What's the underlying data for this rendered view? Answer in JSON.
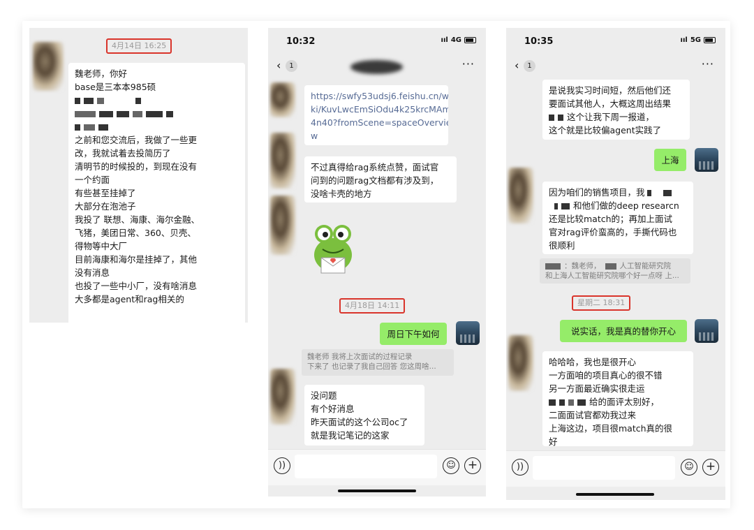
{
  "panel1": {
    "timestamp": "4月14日 16:25",
    "message_lines": [
      "魏老师，你好",
      "base是三本本985硕",
      "之前和您交流后，我做了一些更",
      "改，我就试着去投简历了",
      "清明节的时候投的，到现在没有",
      "一个约面",
      "有些甚至挂掉了",
      "大部分在泡池子",
      "我投了 联想、海康、海尔金融、",
      "飞猪，美团日常、360、贝壳、",
      "得物等中大厂",
      "目前海康和海尔是挂掉了，其他",
      "没有消息",
      "也投了一些中小厂，没有啥消息",
      "大多都是agent和rag相关的"
    ]
  },
  "panel2": {
    "status_time": "10:32",
    "network": "4G",
    "unread_badge": "1",
    "link_lines": [
      "https://swfy53udsj6.feishu.cn/wi",
      "ki/KuvLwcEmSiOdu4k25krcMAm",
      "4n40?fromScene=spaceOvervie",
      "w"
    ],
    "praise_lines": [
      "不过真得给rag系统点赞，面试官",
      "问到的问题rag文档都有涉及到，",
      "没啥卡壳的地方"
    ],
    "timestamp": "4月18日 14:11",
    "my_message": "周日下午如何",
    "quote_lines": [
      "魏老师 我将上次面试的过程记录",
      "下来了 也记录了我自己回答 您这周啥..."
    ],
    "reply_lines": [
      "没问题",
      "有个好消息",
      "昨天面试的这个公司oc了",
      "就是我记笔记的这家"
    ]
  },
  "panel3": {
    "status_time": "10:35",
    "network": "5G",
    "unread_badge": "1",
    "top_lines": [
      "是说我实习时间短，然后他们还",
      "要面试其他人，大概这周出结果",
      "这个让我下周一报道，",
      "这个就是比较偏agent实践了"
    ],
    "my_location": "上海",
    "project_lines": [
      "因为咱们的销售项目，我",
      "和他们做的deep researcn",
      "还是比较match的；再加上面试",
      "官对rag评价蛮高的，手撕代码也",
      "很顺利"
    ],
    "quote_lines": [
      "：魏老师，",
      "人工智能研究院",
      "和上海人工智能研究院哪个好一点呀 上..."
    ],
    "timestamp": "星期二 18:31",
    "my_message": "说实话，我是真的替你开心",
    "reply_lines": [
      "哈哈哈，我也是很开心",
      "一方面咱的项目真心的很不错",
      "另一方面最近确实很走运",
      "给的面评太别好，",
      "二面面试官都劝我过来",
      "上海这边，项目很match真的很",
      "好"
    ]
  },
  "icons": {
    "voice": "voice-icon",
    "emoji": "emoji-icon",
    "plus": "plus-icon",
    "back": "chevron-left-icon",
    "more": "more-icon"
  }
}
